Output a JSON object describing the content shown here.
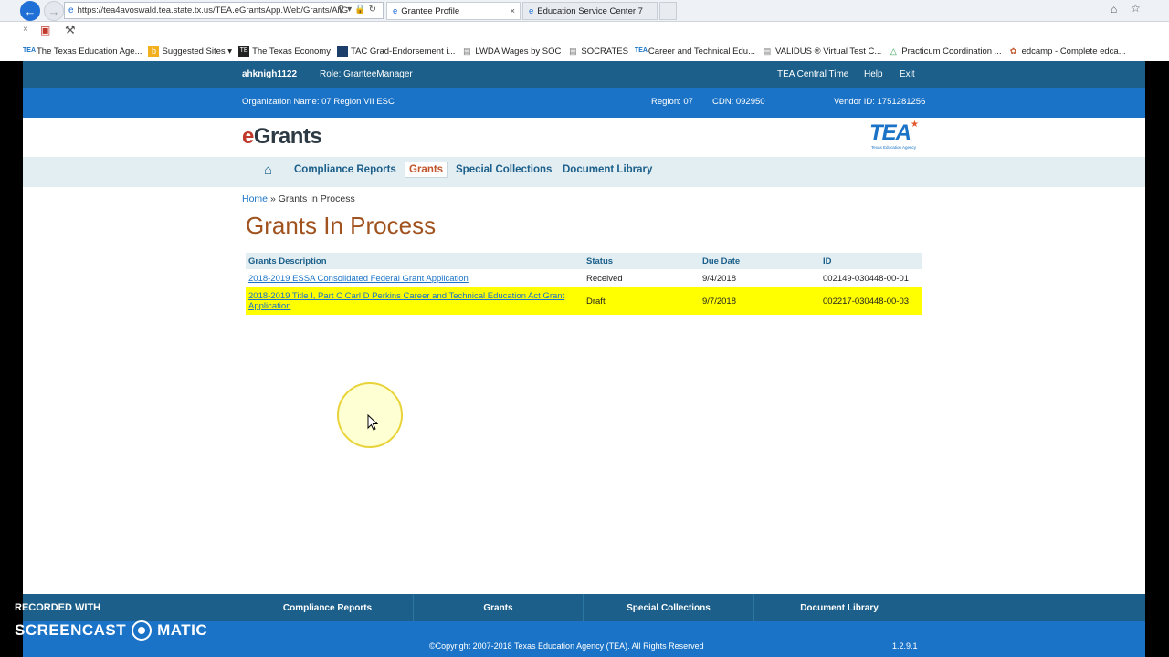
{
  "browser": {
    "url": "https://tea4avoswald.tea.state.tx.us/TEA.eGrantsApp.Web/Grants/AllG",
    "tabs": [
      {
        "label": "Grantee Profile",
        "active": true
      },
      {
        "label": "Education Service Center 7",
        "active": false
      }
    ],
    "favorites": [
      {
        "label": "The Texas Education Age...",
        "icon": "tea-icon"
      },
      {
        "label": "Suggested Sites ▾",
        "icon": "bing-icon"
      },
      {
        "label": "The Texas Economy",
        "icon": "te-icon"
      },
      {
        "label": "TAC Grad-Endorsement i...",
        "icon": "tac-icon"
      },
      {
        "label": "LWDA Wages by SOC",
        "icon": "page-icon"
      },
      {
        "label": "SOCRATES",
        "icon": "page-icon"
      },
      {
        "label": "Career and Technical Edu...",
        "icon": "tea-icon"
      },
      {
        "label": "VALIDUS ® Virtual Test C...",
        "icon": "page-icon"
      },
      {
        "label": "Practicum Coordination ...",
        "icon": "drive-icon"
      },
      {
        "label": "edcamp - Complete edca...",
        "icon": "edcamp-icon"
      }
    ]
  },
  "userbar": {
    "username": "ahknigh1122",
    "role": "Role: GranteeManager",
    "central_time": "TEA Central Time",
    "help": "Help",
    "exit": "Exit"
  },
  "orgbar": {
    "org_name": "Organization Name: 07 Region VII ESC",
    "region": "Region: 07",
    "cdn": "CDN: 092950",
    "vendor": "Vendor ID: 1751281256"
  },
  "logo": {
    "e": "e",
    "rest": "Grants",
    "tea": "TEA",
    "tea_sub": "Texas Education Agency"
  },
  "nav": {
    "compliance": "Compliance Reports",
    "grants": "Grants",
    "special": "Special Collections",
    "library": "Document Library"
  },
  "breadcrumb": {
    "home": "Home",
    "sep": "»",
    "current": "Grants In Process"
  },
  "page_title": "Grants In Process",
  "table": {
    "headers": [
      "Grants Description",
      "Status",
      "Due Date",
      "ID"
    ],
    "rows": [
      {
        "desc": "2018-2019 ESSA Consolidated Federal Grant Application",
        "status": "Received",
        "due": "9/4/2018",
        "id": "002149-030448-00-01",
        "highlight": false
      },
      {
        "desc": "2018-2019 Title I, Part C Carl D Perkins Career and Technical Education Act Grant Application",
        "status": "Draft",
        "due": "9/7/2018",
        "id": "002217-030448-00-03",
        "highlight": true
      }
    ]
  },
  "footer_nav": [
    "Compliance Reports",
    "Grants",
    "Special Collections",
    "Document Library"
  ],
  "footer": {
    "copyright": "©Copyright 2007-2018 Texas Education Agency (TEA). All Rights Reserved",
    "version": "1.2.9.1"
  },
  "watermark": {
    "recorded": "RECORDED WITH",
    "brand_left": "SCREENCAST",
    "brand_right": "MATIC"
  },
  "colors": {
    "userbar": "#1b5f8a",
    "orgbar": "#1a73c7",
    "title": "#a0521f",
    "highlight": "#ffff00",
    "link": "#1a73c7"
  }
}
